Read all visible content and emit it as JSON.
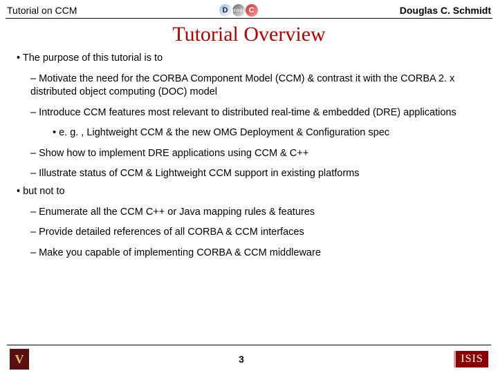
{
  "header": {
    "left": "Tutorial on CCM",
    "right": "Douglas C. Schmidt",
    "logo_letters": [
      "D",
      "group",
      "C"
    ]
  },
  "title": "Tutorial Overview",
  "bullets": [
    {
      "level": 1,
      "marker": "dot",
      "text": "The purpose of this tutorial is to"
    },
    {
      "level": 2,
      "marker": "dash",
      "text": "Motivate the need for the CORBA Component Model (CCM) & contrast it with the CORBA 2. x distributed object computing (DOC) model"
    },
    {
      "level": 2,
      "marker": "dash",
      "text": "Introduce CCM features most relevant to distributed real-time & embedded (DRE) applications"
    },
    {
      "level": 3,
      "marker": "dot",
      "text": "e. g. , Lightweight CCM & the new OMG Deployment & Configuration spec"
    },
    {
      "level": 2,
      "marker": "dash",
      "text": "Show how to implement DRE applications using CCM & C++"
    },
    {
      "level": 2,
      "marker": "dash",
      "text": "Illustrate status of CCM & Lightweight CCM support in existing platforms"
    },
    {
      "level": 1,
      "marker": "dot",
      "text": "but not to"
    },
    {
      "level": 2,
      "marker": "dash",
      "text": "Enumerate all the CCM C++ or Java mapping rules & features"
    },
    {
      "level": 2,
      "marker": "dash",
      "text": "Provide detailed references of all CORBA & CCM interfaces"
    },
    {
      "level": 2,
      "marker": "dash",
      "text": "Make you capable of implementing CORBA & CCM middleware"
    }
  ],
  "footer": {
    "page": "3",
    "left_logo_letter": "V",
    "right_logo_text": "ISIS"
  }
}
